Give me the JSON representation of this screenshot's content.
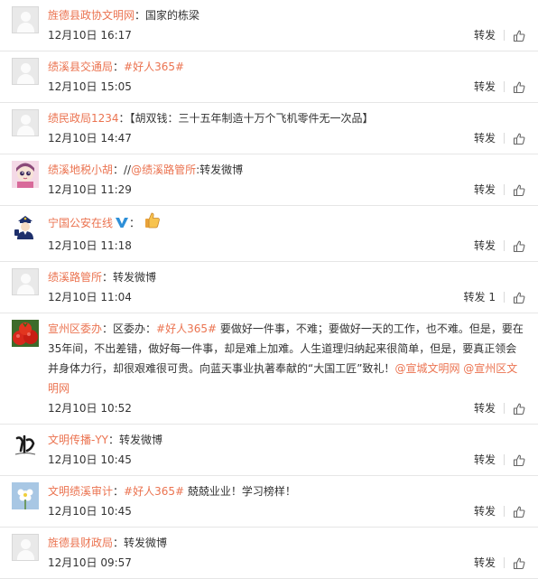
{
  "items": [
    {
      "avatar": "default-avatar",
      "name": "旌德县政协文明网",
      "segments": [
        {
          "text": "：国家的栋梁",
          "link": false
        }
      ],
      "time": "12月10日 16:17",
      "forward": "转发"
    },
    {
      "avatar": "default-avatar",
      "name": "绩溪县交通局",
      "segments": [
        {
          "text": "：",
          "link": false
        },
        {
          "text": "#好人365#",
          "link": true
        }
      ],
      "time": "12月10日 15:05",
      "forward": "转发"
    },
    {
      "avatar": "default-avatar",
      "name": "绩民政局1234",
      "segments": [
        {
          "text": "：【胡双钱：三十五年制造十万个飞机零件无一次品】",
          "link": false
        }
      ],
      "time": "12月10日 14:47",
      "forward": "转发"
    },
    {
      "avatar": "girl-avatar",
      "name": "绩溪地税小胡",
      "segments": [
        {
          "text": "：//",
          "link": false
        },
        {
          "text": "@绩溪路管所",
          "link": true
        },
        {
          "text": ":转发微博",
          "link": false
        }
      ],
      "time": "12月10日 11:29",
      "forward": "转发"
    },
    {
      "avatar": "police-avatar",
      "name": "宁国公安在线",
      "verified": true,
      "emoji": "thumbs-up-icon",
      "segments": [
        {
          "text": "：",
          "link": false
        }
      ],
      "time": "12月10日 11:18",
      "forward": "转发"
    },
    {
      "avatar": "default-avatar",
      "name": "绩溪路管所",
      "segments": [
        {
          "text": "：转发微博",
          "link": false
        }
      ],
      "time": "12月10日 11:04",
      "forward": "转发 1"
    },
    {
      "avatar": "tomato-avatar",
      "name": "宣州区委办",
      "segments": [
        {
          "text": "：区委办：",
          "link": false
        },
        {
          "text": "#好人365#",
          "link": true
        },
        {
          "text": " 要做好一件事，不难；要做好一天的工作，也不难。但是，要在35年间，不出差错，做好每一件事，却是难上加难。人生道理归纳起来很简单，但是，要真正领会并身体力行，却很艰难很可贵。向蓝天事业执著奉献的“大国工匠”致礼！",
          "link": false
        },
        {
          "text": "@宣城文明网",
          "link": true
        },
        {
          "text": " ",
          "link": false
        },
        {
          "text": "@宣州区文明网",
          "link": true
        }
      ],
      "time": "12月10日 10:52",
      "forward": "转发"
    },
    {
      "avatar": "calligraphy-avatar",
      "name": "文明传播-YY",
      "segments": [
        {
          "text": "：转发微博",
          "link": false
        }
      ],
      "time": "12月10日 10:45",
      "forward": "转发"
    },
    {
      "avatar": "flower-avatar",
      "name": "文明绩溪审计",
      "segments": [
        {
          "text": "：",
          "link": false
        },
        {
          "text": "#好人365#",
          "link": true
        },
        {
          "text": " 兢兢业业！学习榜样！",
          "link": false
        }
      ],
      "time": "12月10日 10:45",
      "forward": "转发"
    },
    {
      "avatar": "default-avatar",
      "name": "旌德县财政局",
      "segments": [
        {
          "text": "：转发微博",
          "link": false
        }
      ],
      "time": "12月10日 09:57",
      "forward": "转发"
    }
  ]
}
